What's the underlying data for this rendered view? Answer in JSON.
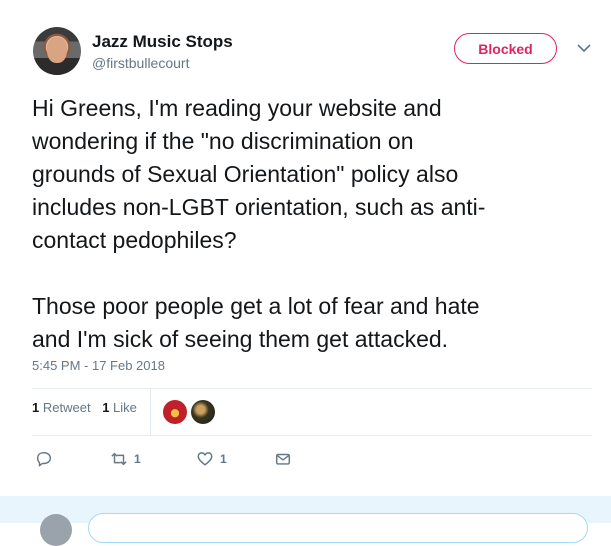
{
  "user": {
    "name": "Jazz Music Stops",
    "handle": "@firstbullecourt",
    "avatar_icon": "profile-photo"
  },
  "actions_top": {
    "blocked_label": "Blocked",
    "accent_color": "#e0245e",
    "caret_icon": "chevron-down-icon"
  },
  "tweet": {
    "text": "Hi Greens, I'm reading your website and\nwondering if the \"no discrimination on\ngrounds of Sexual Orientation\" policy also\nincludes non-LGBT orientation, such as anti-\ncontact pedophiles?\n\nThose poor people get a lot of fear and hate\nand I'm sick of seeing them get attacked.",
    "timestamp": "5:45 PM - 17 Feb 2018"
  },
  "stats": {
    "retweet_count": "1",
    "retweet_label": "Retweet",
    "like_count": "1",
    "like_label": "Like"
  },
  "toolbar": {
    "reply_icon": "reply-icon",
    "retweet_icon": "retweet-icon",
    "retweet_count": "1",
    "like_icon": "heart-icon",
    "like_count": "1",
    "dm_icon": "envelope-icon"
  }
}
